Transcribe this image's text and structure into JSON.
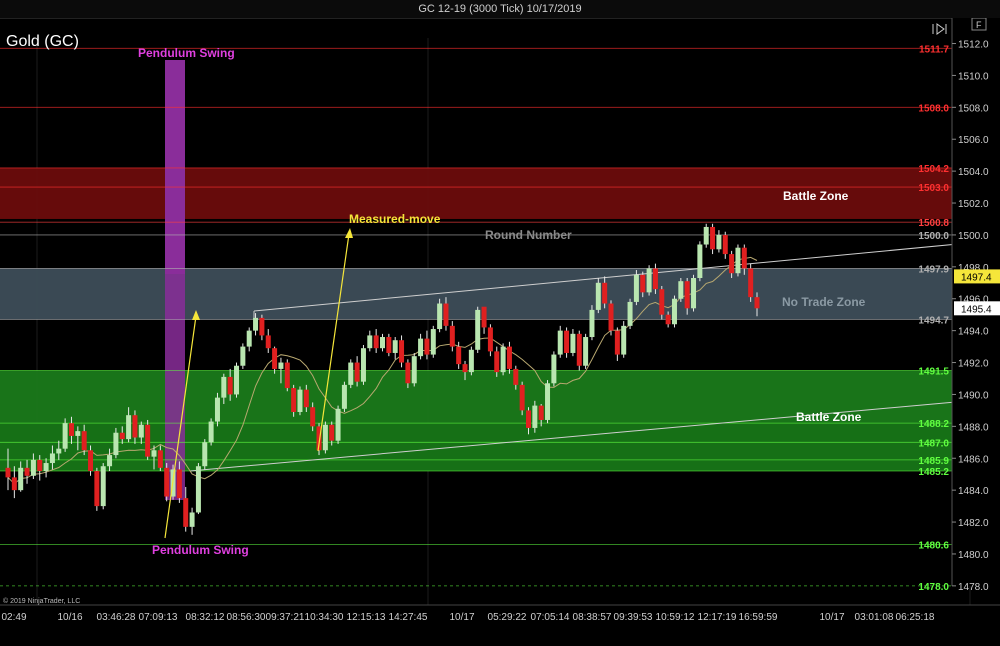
{
  "window_title": "GC 12-19 (3000 Tick)  10/17/2019",
  "instrument_label": "Gold (GC)",
  "copyright": "© 2019 NinjaTrader, LLC",
  "toolbar_icons": [
    "panel-toggle-icon",
    "f-button-icon"
  ],
  "toolbar_f_label": "F",
  "colors": {
    "background": "#000000",
    "up_candle": "#b9e6b0",
    "down_candle": "#e02020",
    "battle_zone_red": "#6b0c0c",
    "no_trade_zone": "#3d4d58",
    "battle_zone_green": "#1a7a1a",
    "pendulum": "#8a2d9a",
    "measured_move": "#f5e63a",
    "ma_line": "#b8a870"
  },
  "price_axis": {
    "min": 1476.8,
    "max": 1513.6,
    "ticks": [
      "1512.0",
      "1510.0",
      "1508.0",
      "1506.0",
      "1504.0",
      "1502.0",
      "1500.0",
      "1498.0",
      "1496.0",
      "1494.0",
      "1492.0",
      "1490.0",
      "1488.0",
      "1486.0",
      "1484.0",
      "1482.0",
      "1480.0",
      "1478.0"
    ],
    "last_price": "1495.4",
    "marker_price": "1497.4"
  },
  "time_axis": {
    "labels": [
      "02:49",
      "10/16",
      "03:46:28",
      "07:09:13",
      "08:32:12",
      "08:56:30",
      "09:37:21",
      "10:34:30",
      "12:15:13",
      "14:27:45",
      "10/17",
      "05:29:22",
      "07:05:14",
      "08:38:57",
      "09:39:53",
      "10:59:12",
      "12:17:19",
      "16:59:59",
      "10/17",
      "03:01:08",
      "06:25:18"
    ]
  },
  "levels": [
    {
      "value": "1511.7",
      "color": "#ff3030"
    },
    {
      "value": "1508.0",
      "color": "#ff3030"
    },
    {
      "value": "1504.2",
      "color": "#ff3030"
    },
    {
      "value": "1503.0",
      "color": "#ff3030"
    },
    {
      "value": "1500.8",
      "color": "#ff4040"
    },
    {
      "value": "1500.0",
      "color": "#b0b0b0"
    },
    {
      "value": "1497.9",
      "color": "#b0b0b0"
    },
    {
      "value": "1494.7",
      "color": "#b0b0b0"
    },
    {
      "value": "1491.5",
      "color": "#60ff40"
    },
    {
      "value": "1488.2",
      "color": "#60ff40"
    },
    {
      "value": "1487.0",
      "color": "#60ff40"
    },
    {
      "value": "1485.9",
      "color": "#60ff40"
    },
    {
      "value": "1485.2",
      "color": "#60ff40"
    },
    {
      "value": "1480.6",
      "color": "#60ff40"
    },
    {
      "value": "1478.0",
      "color": "#60ff40"
    }
  ],
  "zones": [
    {
      "label": "Battle Zone",
      "lo": 1501.0,
      "hi": 1504.2,
      "color": "#6b0c0c"
    },
    {
      "label": "No Trade Zone",
      "lo": 1494.7,
      "hi": 1497.9,
      "color": "#3d4d58"
    },
    {
      "label": "Battle Zone",
      "lo": 1485.2,
      "hi": 1491.5,
      "color": "#1a7a1a"
    }
  ],
  "annotations": {
    "pendulum_top": "Pendulum Swing",
    "pendulum_bottom": "Pendulum Swing",
    "measured_move": "Measured-move",
    "round_number": "Round Number"
  },
  "candles": [
    [
      1485.4,
      1486.6,
      1484.0,
      1484.8
    ],
    [
      1484.8,
      1485.5,
      1483.5,
      1484.0
    ],
    [
      1484.0,
      1485.8,
      1483.9,
      1485.4
    ],
    [
      1485.4,
      1485.9,
      1484.4,
      1484.9
    ],
    [
      1484.9,
      1486.3,
      1484.7,
      1485.9
    ],
    [
      1485.9,
      1486.2,
      1484.6,
      1485.2
    ],
    [
      1485.2,
      1486.0,
      1484.8,
      1485.7
    ],
    [
      1485.7,
      1486.8,
      1485.3,
      1486.3
    ],
    [
      1486.3,
      1487.1,
      1485.9,
      1486.6
    ],
    [
      1486.6,
      1488.5,
      1486.4,
      1488.2
    ],
    [
      1488.2,
      1488.6,
      1486.9,
      1487.4
    ],
    [
      1487.4,
      1488.0,
      1486.5,
      1487.7
    ],
    [
      1487.7,
      1488.1,
      1486.2,
      1486.5
    ],
    [
      1486.5,
      1486.8,
      1484.9,
      1485.2
    ],
    [
      1485.2,
      1485.4,
      1482.7,
      1483.0
    ],
    [
      1483.0,
      1485.7,
      1482.8,
      1485.5
    ],
    [
      1485.5,
      1486.6,
      1485.2,
      1486.2
    ],
    [
      1486.2,
      1487.9,
      1486.0,
      1487.6
    ],
    [
      1487.6,
      1488.0,
      1486.9,
      1487.2
    ],
    [
      1487.2,
      1489.2,
      1487.0,
      1488.7
    ],
    [
      1488.7,
      1489.0,
      1486.9,
      1487.3
    ],
    [
      1487.3,
      1488.3,
      1486.9,
      1488.1
    ],
    [
      1488.1,
      1488.4,
      1485.9,
      1486.1
    ],
    [
      1486.1,
      1486.8,
      1485.3,
      1486.5
    ],
    [
      1486.5,
      1486.8,
      1485.2,
      1485.4
    ],
    [
      1485.4,
      1485.7,
      1483.3,
      1483.6
    ],
    [
      1483.6,
      1485.6,
      1483.4,
      1485.3
    ],
    [
      1485.3,
      1485.8,
      1483.2,
      1483.5
    ],
    [
      1483.5,
      1484.2,
      1481.4,
      1481.7
    ],
    [
      1481.7,
      1482.9,
      1481.2,
      1482.6
    ],
    [
      1482.6,
      1485.7,
      1482.5,
      1485.5
    ],
    [
      1485.5,
      1487.2,
      1485.3,
      1487.0
    ],
    [
      1487.0,
      1488.5,
      1486.8,
      1488.3
    ],
    [
      1488.3,
      1490.1,
      1488.0,
      1489.8
    ],
    [
      1489.8,
      1491.3,
      1489.4,
      1491.1
    ],
    [
      1491.1,
      1491.6,
      1489.6,
      1490.0
    ],
    [
      1490.0,
      1492.0,
      1489.8,
      1491.8
    ],
    [
      1491.8,
      1493.2,
      1491.6,
      1493.0
    ],
    [
      1493.0,
      1494.2,
      1492.7,
      1494.0
    ],
    [
      1494.0,
      1495.1,
      1493.7,
      1494.8
    ],
    [
      1494.8,
      1495.0,
      1493.4,
      1493.7
    ],
    [
      1493.7,
      1494.1,
      1492.6,
      1492.9
    ],
    [
      1492.9,
      1493.0,
      1491.3,
      1491.6
    ],
    [
      1491.6,
      1492.3,
      1490.7,
      1492.0
    ],
    [
      1492.0,
      1492.2,
      1490.2,
      1490.4
    ],
    [
      1490.4,
      1490.6,
      1488.6,
      1488.9
    ],
    [
      1488.9,
      1490.5,
      1488.7,
      1490.3
    ],
    [
      1490.3,
      1490.6,
      1488.9,
      1489.2
    ],
    [
      1489.2,
      1489.5,
      1487.7,
      1488.0
    ],
    [
      1488.0,
      1488.2,
      1486.2,
      1486.5
    ],
    [
      1486.5,
      1488.3,
      1486.3,
      1488.1
    ],
    [
      1488.1,
      1488.3,
      1486.8,
      1487.1
    ],
    [
      1487.1,
      1489.3,
      1486.9,
      1489.1
    ],
    [
      1489.1,
      1490.8,
      1488.9,
      1490.6
    ],
    [
      1490.6,
      1492.2,
      1490.4,
      1492.0
    ],
    [
      1492.0,
      1492.4,
      1490.5,
      1490.8
    ],
    [
      1490.8,
      1493.1,
      1490.6,
      1492.9
    ],
    [
      1492.9,
      1494.0,
      1492.7,
      1493.7
    ],
    [
      1493.7,
      1494.1,
      1492.6,
      1492.9
    ],
    [
      1492.9,
      1493.8,
      1492.7,
      1493.6
    ],
    [
      1493.6,
      1493.8,
      1492.4,
      1492.6
    ],
    [
      1492.6,
      1493.6,
      1492.2,
      1493.4
    ],
    [
      1493.4,
      1493.7,
      1491.7,
      1492.0
    ],
    [
      1492.0,
      1492.2,
      1490.4,
      1490.7
    ],
    [
      1490.7,
      1492.6,
      1490.5,
      1492.4
    ],
    [
      1492.4,
      1493.8,
      1492.2,
      1493.5
    ],
    [
      1493.5,
      1494.0,
      1492.2,
      1492.5
    ],
    [
      1492.5,
      1494.3,
      1492.3,
      1494.1
    ],
    [
      1494.1,
      1496.0,
      1493.9,
      1495.7
    ],
    [
      1495.7,
      1496.1,
      1494.0,
      1494.3
    ],
    [
      1494.3,
      1494.6,
      1492.7,
      1493.0
    ],
    [
      1493.0,
      1493.3,
      1491.6,
      1491.9
    ],
    [
      1491.9,
      1492.1,
      1490.9,
      1491.4
    ],
    [
      1491.4,
      1493.0,
      1491.2,
      1492.8
    ],
    [
      1492.8,
      1495.5,
      1492.6,
      1495.3
    ],
    [
      1495.5,
      1495.3,
      1493.8,
      1494.2
    ],
    [
      1494.2,
      1494.4,
      1492.4,
      1492.7
    ],
    [
      1492.7,
      1493.0,
      1491.1,
      1491.4
    ],
    [
      1491.4,
      1493.2,
      1491.2,
      1493.0
    ],
    [
      1493.0,
      1493.3,
      1491.3,
      1491.6
    ],
    [
      1491.6,
      1491.8,
      1490.3,
      1490.6
    ],
    [
      1490.6,
      1490.8,
      1488.7,
      1489.0
    ],
    [
      1489.0,
      1489.2,
      1487.5,
      1487.9
    ],
    [
      1487.9,
      1489.6,
      1487.6,
      1489.3
    ],
    [
      1489.3,
      1489.4,
      1488.0,
      1488.4
    ],
    [
      1488.4,
      1490.9,
      1488.2,
      1490.7
    ],
    [
      1490.7,
      1492.7,
      1490.5,
      1492.5
    ],
    [
      1492.5,
      1494.3,
      1492.3,
      1494.0
    ],
    [
      1494.0,
      1494.2,
      1492.3,
      1492.6
    ],
    [
      1492.6,
      1494.1,
      1492.4,
      1493.8
    ],
    [
      1493.8,
      1494.0,
      1491.5,
      1491.8
    ],
    [
      1491.8,
      1493.8,
      1491.6,
      1493.6
    ],
    [
      1493.6,
      1495.6,
      1493.4,
      1495.3
    ],
    [
      1495.3,
      1497.3,
      1495.1,
      1497.0
    ],
    [
      1497.0,
      1497.4,
      1495.4,
      1495.7
    ],
    [
      1495.7,
      1495.9,
      1493.7,
      1494.0
    ],
    [
      1494.0,
      1494.2,
      1492.1,
      1492.5
    ],
    [
      1492.5,
      1494.6,
      1492.3,
      1494.3
    ],
    [
      1494.3,
      1496.0,
      1494.1,
      1495.8
    ],
    [
      1495.8,
      1497.8,
      1495.6,
      1497.5
    ],
    [
      1497.5,
      1497.7,
      1496.1,
      1496.4
    ],
    [
      1496.4,
      1498.1,
      1496.2,
      1497.9
    ],
    [
      1497.9,
      1498.2,
      1496.3,
      1496.6
    ],
    [
      1496.6,
      1496.8,
      1494.7,
      1495.0
    ],
    [
      1495.0,
      1495.2,
      1494.2,
      1494.4
    ],
    [
      1494.4,
      1496.2,
      1494.2,
      1496.0
    ],
    [
      1496.0,
      1497.3,
      1495.8,
      1497.1
    ],
    [
      1497.1,
      1497.3,
      1495.0,
      1495.4
    ],
    [
      1495.4,
      1497.5,
      1495.2,
      1497.3
    ],
    [
      1497.3,
      1499.6,
      1497.1,
      1499.4
    ],
    [
      1499.4,
      1500.7,
      1499.2,
      1500.5
    ],
    [
      1500.5,
      1500.7,
      1498.8,
      1499.1
    ],
    [
      1499.1,
      1500.3,
      1498.9,
      1500.0
    ],
    [
      1500.0,
      1500.2,
      1498.5,
      1498.8
    ],
    [
      1498.8,
      1499.0,
      1497.3,
      1497.6
    ],
    [
      1497.6,
      1499.4,
      1497.4,
      1499.2
    ],
    [
      1499.2,
      1499.4,
      1497.5,
      1497.9
    ],
    [
      1497.9,
      1498.2,
      1495.8,
      1496.1
    ],
    [
      1496.1,
      1496.4,
      1494.9,
      1495.4
    ]
  ]
}
